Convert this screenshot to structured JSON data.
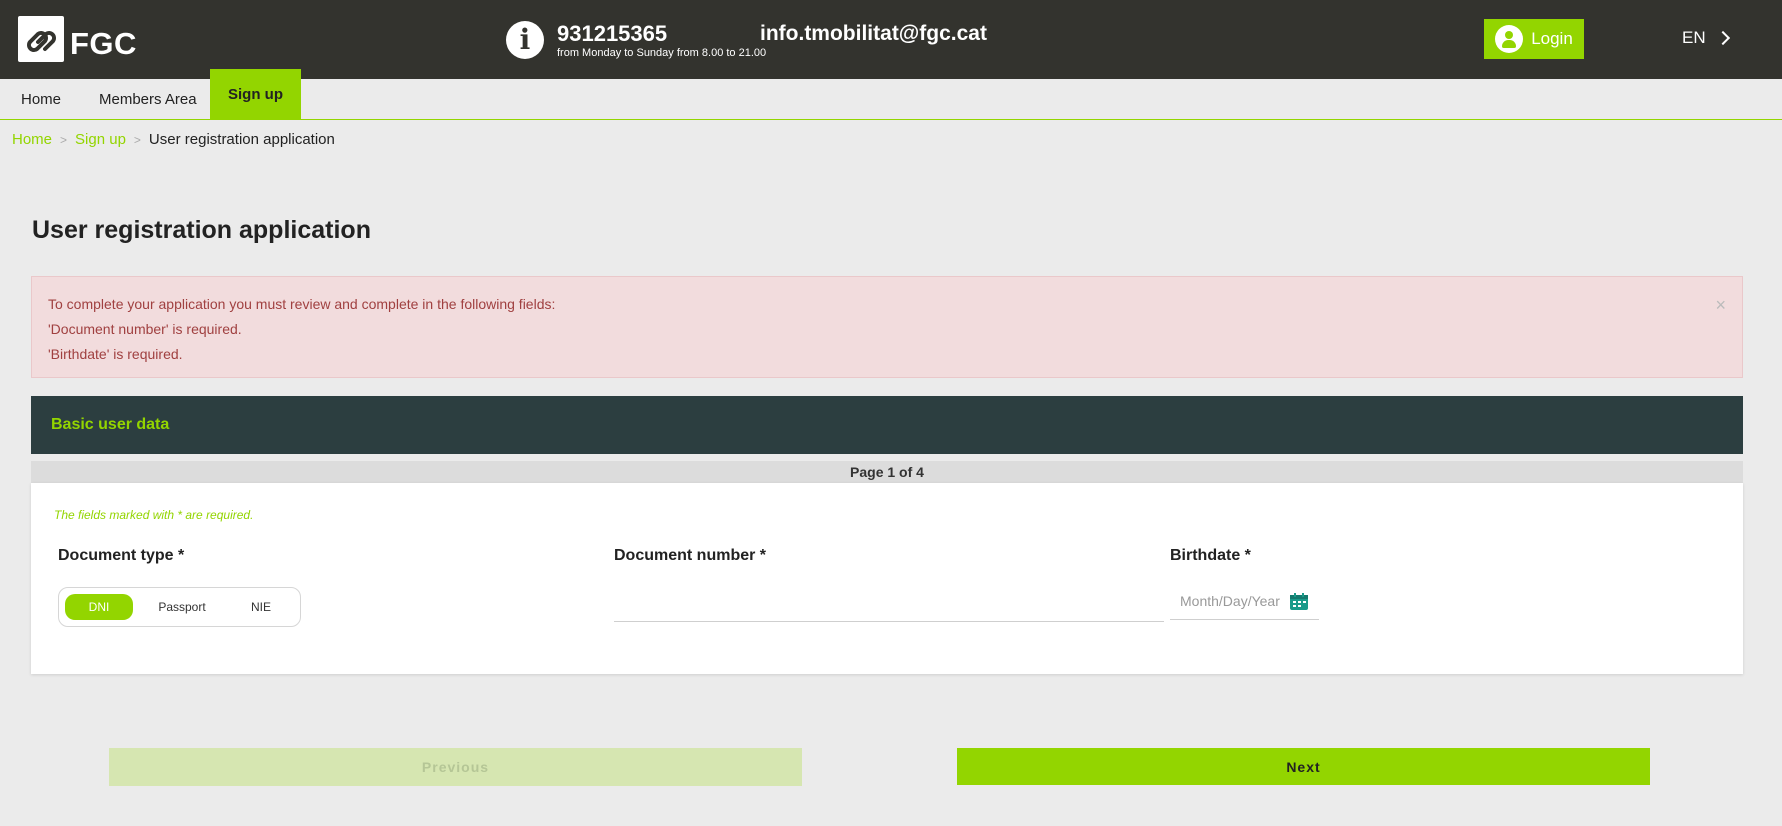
{
  "header": {
    "logo_text": "FGC",
    "phone": "931215365",
    "hours": "from Monday to Sunday from 8.00 to 21.00",
    "email": "info.tmobilitat@fgc.cat",
    "login_label": "Login",
    "language": "EN"
  },
  "nav": {
    "items": [
      "Home",
      "Members Area",
      "Sign up"
    ],
    "active": "Sign up"
  },
  "breadcrumb": {
    "items": [
      "Home",
      "Sign up"
    ],
    "separator": ">",
    "current": "User registration application"
  },
  "page": {
    "title": "User registration application"
  },
  "alert": {
    "lines": [
      "To complete your application you must review and complete in the following fields:",
      "'Document number' is required.",
      "'Birthdate' is required."
    ],
    "close_symbol": "×"
  },
  "form": {
    "section_title": "Basic user data",
    "page_indicator": "Page 1 of 4",
    "required_note": "The fields marked with * are required.",
    "document_type": {
      "label": "Document type *",
      "options": [
        "DNI",
        "Passport",
        "NIE"
      ],
      "selected": "DNI"
    },
    "document_number": {
      "label": "Document number *",
      "value": ""
    },
    "birthdate": {
      "label": "Birthdate *",
      "placeholder": "Month/Day/Year",
      "value": ""
    }
  },
  "buttons": {
    "previous": "Previous",
    "next": "Next"
  },
  "colors": {
    "accent": "#93d500",
    "header_bg": "#33332e",
    "section_bg": "#2c3e40",
    "alert_bg": "#f2dcdd",
    "alert_text": "#a04040"
  }
}
